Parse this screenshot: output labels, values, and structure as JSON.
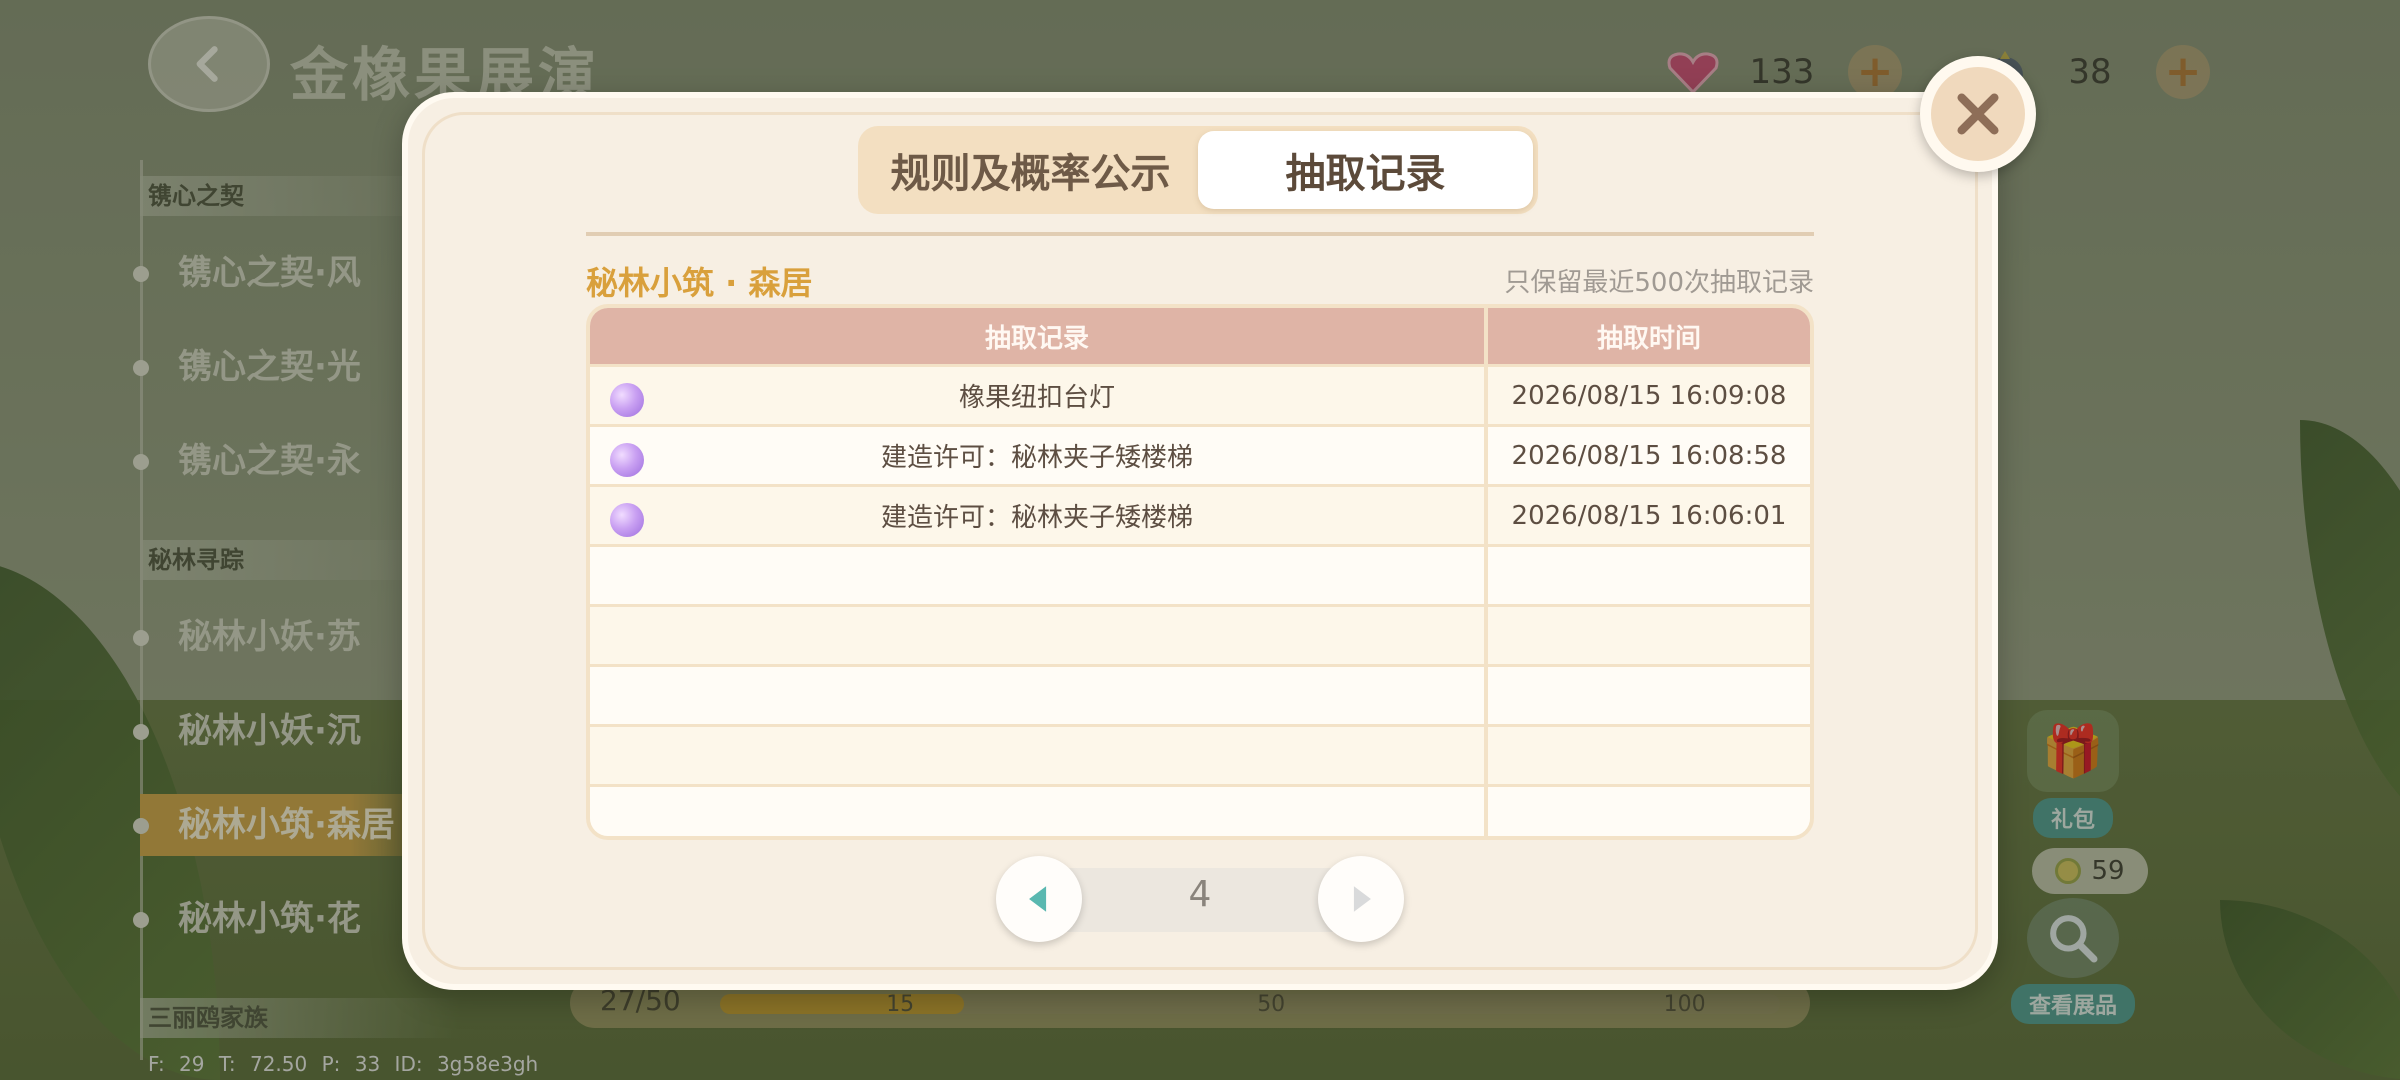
{
  "header": {
    "title": "金橡果展演",
    "currencies": [
      {
        "icon": "heart-gem-icon",
        "value": "133"
      },
      {
        "icon": "bell-fruit-icon",
        "value": "38"
      }
    ]
  },
  "sidebar": {
    "groups": [
      {
        "label": "镌心之契",
        "items": [
          "镌心之契·风",
          "镌心之契·光",
          "镌心之契·永"
        ]
      },
      {
        "label": "秘林寻踪",
        "items": [
          "秘林小妖·苏",
          "秘林小妖·沉",
          "秘林小筑·森居",
          "秘林小筑·花"
        ]
      },
      {
        "label": "三丽鸥家族",
        "items": []
      }
    ],
    "active_item": "秘林小筑·森居"
  },
  "right_panel": {
    "gift_label": "礼包",
    "coin_value": "59",
    "view_label": "查看展品"
  },
  "progress": {
    "text": "27/50",
    "fraction": 0.23,
    "ticks": [
      "15",
      "50",
      "100"
    ]
  },
  "debug": "F: 29   T: 72.50   P: 33   ID: 3g58e3gh",
  "modal": {
    "tabs": [
      "规则及概率公示",
      "抽取记录"
    ],
    "selected_tab": 1,
    "pool_name": "秘林小筑 · 森居",
    "note": "只保留最近500次抽取记录",
    "table": {
      "headers": [
        "抽取记录",
        "抽取时间"
      ],
      "rows": [
        {
          "item": "橡果纽扣台灯",
          "time": "2026/08/15 16:09:08",
          "rarity_color": "#b98be8"
        },
        {
          "item": "建造许可：秘林夹子矮楼梯",
          "time": "2026/08/15 16:08:58",
          "rarity_color": "#b98be8"
        },
        {
          "item": "建造许可：秘林夹子矮楼梯",
          "time": "2026/08/15 16:06:01",
          "rarity_color": "#b98be8"
        },
        {
          "item": "",
          "time": ""
        },
        {
          "item": "",
          "time": ""
        },
        {
          "item": "",
          "time": ""
        },
        {
          "item": "",
          "time": ""
        },
        {
          "item": "",
          "time": ""
        }
      ]
    },
    "page": "4"
  },
  "colors": {
    "accent": "#d9a03c",
    "header_row": "#dfb4a6",
    "teal": "#4f9e95"
  }
}
